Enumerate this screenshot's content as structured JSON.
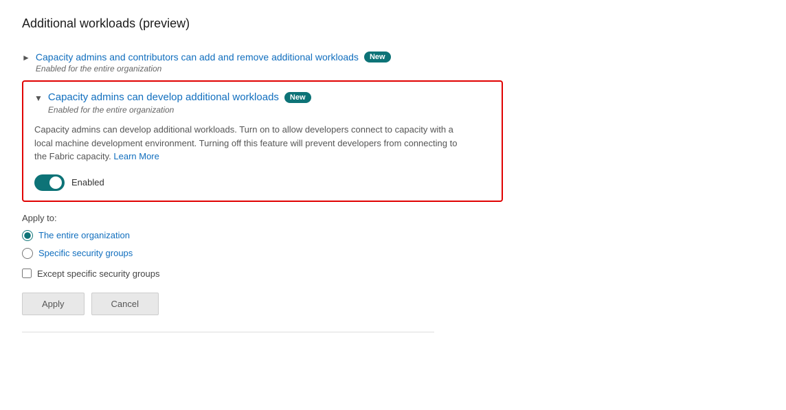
{
  "page": {
    "title": "Additional workloads (preview)"
  },
  "collapsed_item": {
    "title": "Capacity admins and contributors can add and remove additional workloads",
    "badge": "New",
    "subtitle": "Enabled for the entire organization"
  },
  "expanded_item": {
    "title": "Capacity admins can develop additional workloads",
    "badge": "New",
    "subtitle": "Enabled for the entire organization",
    "description_part1": "Capacity admins can develop additional workloads. Turn on to allow developers connect to capacity with a local machine development environment. Turning off this feature will prevent developers from connecting to the Fabric capacity.",
    "learn_more_label": "Learn More",
    "toggle_label": "Enabled"
  },
  "apply_to": {
    "title": "Apply to:",
    "options": [
      {
        "id": "entire-org",
        "label": "The entire organization",
        "checked": true
      },
      {
        "id": "specific-groups",
        "label": "Specific security groups",
        "checked": false
      }
    ],
    "checkbox": {
      "id": "except-groups",
      "label": "Except specific security groups",
      "checked": false
    }
  },
  "buttons": {
    "apply": "Apply",
    "cancel": "Cancel"
  }
}
